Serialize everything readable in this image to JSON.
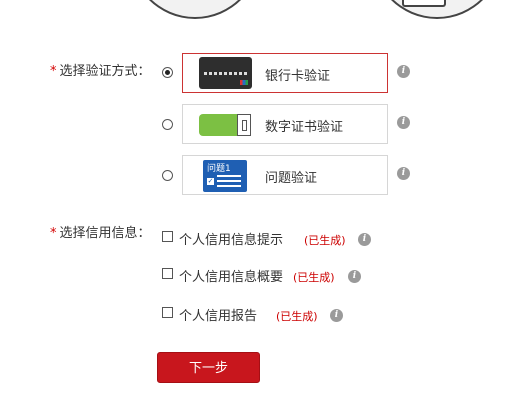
{
  "verify_method": {
    "label": "选择验证方式：",
    "required_mark": "*",
    "options": [
      {
        "label": "银行卡验证",
        "checked": true,
        "icon": "bank-card-icon"
      },
      {
        "label": "数字证书验证",
        "checked": false,
        "icon": "digital-certificate-icon"
      },
      {
        "label": "问题验证",
        "checked": false,
        "icon": "question-icon",
        "icon_text": "问题1"
      }
    ]
  },
  "credit_info": {
    "label": "选择信用信息：",
    "required_mark": "*",
    "items": [
      {
        "label": "个人信用信息提示",
        "status": "(已生成)",
        "checked": false
      },
      {
        "label": "个人信用信息概要",
        "status": "(已生成)",
        "checked": false
      },
      {
        "label": "个人信用报告",
        "status": "(已生成)",
        "checked": false
      }
    ]
  },
  "help_icon_glyph": "i",
  "next_button": {
    "label": "下一步"
  },
  "colors": {
    "accent_red": "#c8161d",
    "required_red": "#d40000",
    "cert_green": "#7cc043",
    "question_blue": "#1f5fb3"
  }
}
